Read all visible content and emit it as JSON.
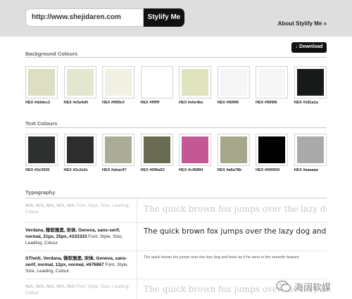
{
  "header": {
    "url_value": "http://www.shejidaren.com",
    "submit_label": "Stylify Me",
    "about_label": "About Stylify Me »"
  },
  "background_colours": {
    "title": "Background Colours",
    "download_label": "Download",
    "swatches": [
      {
        "hex": "#dddec2",
        "label": "HEX #dddec2"
      },
      {
        "hex": "#e5e6d0",
        "label": "HEX #e5e6d0"
      },
      {
        "hex": "#f0f0e3",
        "label": "HEX #f0f0e3"
      },
      {
        "hex": "#ffffff",
        "label": "HEX #ffffff"
      },
      {
        "hex": "#e0e4be",
        "label": "HEX #e0e4be"
      },
      {
        "hex": "#f6f6f6",
        "label": "HEX #f6f6f6"
      },
      {
        "hex": "#f6f6f6",
        "label": "HEX #f6f6f6"
      },
      {
        "hex": "#181a1a",
        "label": "HEX #181a1a"
      }
    ]
  },
  "text_colours": {
    "title": "Text Colours",
    "swatches": [
      {
        "hex": "#2e3030",
        "label": "HEX #2e3030"
      },
      {
        "hex": "#2c2e2e",
        "label": "HEX #2c2e2e"
      },
      {
        "hex": "#abac97",
        "label": "HEX #abac97"
      },
      {
        "hex": "#696a52",
        "label": "HEX #696a52"
      },
      {
        "hex": "#c45894",
        "label": "HEX #c45894"
      },
      {
        "hex": "#a6a78b",
        "label": "HEX #a6a78b"
      },
      {
        "hex": "#000000",
        "label": "HEX #000000"
      },
      {
        "hex": "#aaaaaa",
        "label": "HEX #aaaaaa"
      }
    ]
  },
  "typography": {
    "title": "Typography",
    "rows": [
      {
        "spec_bold": "N/A, N/A, N/A, N/A, N/A",
        "spec_rest": " Font, Style, Size, Leading, Colour",
        "sample": "The quick brown fox jumps over the lazy dog"
      },
      {
        "spec_bold": "Verdana, 微软雅黑, 宋体, Geneva, sans-serif, normal, 21px, 25px, #333333",
        "spec_rest": " Font, Style, Size, Leading, Colour",
        "sample": "The quick brown fox jumps over the lazy dog and feels as if he were in the seventh heaven"
      },
      {
        "spec_bold": "STheiti, Verdana, 微软雅黑, 宋体, Geneva, sans-serif, normal, 12px, normal, #676867",
        "spec_rest": " Font, Style, Size, Leading, Colour",
        "sample": "The quick brown fox jumps over the lazy dog and feels as if he were in the seventh heaven"
      },
      {
        "spec_bold": "N/A, N/A, N/A, N/A, N/A",
        "spec_rest": " Font, Style, Size, Leading, Colour",
        "sample": "The quick brown fox jumps over the lazy dog"
      }
    ]
  },
  "watermark": {
    "text": "海阔软媒"
  }
}
